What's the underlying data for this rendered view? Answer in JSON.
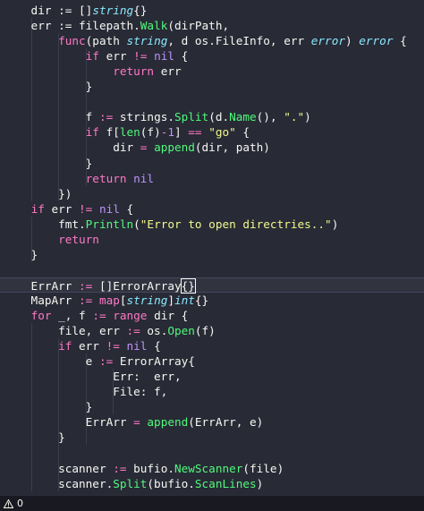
{
  "editor": {
    "lines": [
      [
        {
          "t": "    dir := []",
          "c": "pl"
        },
        {
          "t": "string",
          "c": "ty"
        },
        {
          "t": "{}",
          "c": "pl"
        }
      ],
      [
        {
          "t": "    err := filepath.",
          "c": "pl"
        },
        {
          "t": "Walk",
          "c": "fn"
        },
        {
          "t": "(dirPath,",
          "c": "pl"
        }
      ],
      [
        {
          "t": "        ",
          "c": "pl"
        },
        {
          "t": "func",
          "c": "kw"
        },
        {
          "t": "(path ",
          "c": "pl"
        },
        {
          "t": "string",
          "c": "ty"
        },
        {
          "t": ", d os.FileInfo, err ",
          "c": "pl"
        },
        {
          "t": "error",
          "c": "ty"
        },
        {
          "t": ") ",
          "c": "pl"
        },
        {
          "t": "error",
          "c": "ty"
        },
        {
          "t": " {",
          "c": "pl"
        }
      ],
      [
        {
          "t": "            ",
          "c": "pl"
        },
        {
          "t": "if",
          "c": "kw"
        },
        {
          "t": " err ",
          "c": "pl"
        },
        {
          "t": "!=",
          "c": "kw"
        },
        {
          "t": " ",
          "c": "pl"
        },
        {
          "t": "nil",
          "c": "cn"
        },
        {
          "t": " {",
          "c": "pl"
        }
      ],
      [
        {
          "t": "                ",
          "c": "pl"
        },
        {
          "t": "return",
          "c": "kw"
        },
        {
          "t": " err",
          "c": "pl"
        }
      ],
      [
        {
          "t": "            }",
          "c": "pl"
        }
      ],
      [],
      [
        {
          "t": "            f ",
          "c": "pl"
        },
        {
          "t": ":=",
          "c": "kw"
        },
        {
          "t": " strings.",
          "c": "pl"
        },
        {
          "t": "Split",
          "c": "fn"
        },
        {
          "t": "(d.",
          "c": "pl"
        },
        {
          "t": "Name",
          "c": "fn"
        },
        {
          "t": "(), ",
          "c": "pl"
        },
        {
          "t": "\".\"",
          "c": "st"
        },
        {
          "t": ")",
          "c": "pl"
        }
      ],
      [
        {
          "t": "            ",
          "c": "pl"
        },
        {
          "t": "if",
          "c": "kw"
        },
        {
          "t": " f[",
          "c": "pl"
        },
        {
          "t": "len",
          "c": "fn"
        },
        {
          "t": "(f)",
          "c": "pl"
        },
        {
          "t": "-",
          "c": "kw"
        },
        {
          "t": "1",
          "c": "cn"
        },
        {
          "t": "] ",
          "c": "pl"
        },
        {
          "t": "==",
          "c": "kw"
        },
        {
          "t": " ",
          "c": "pl"
        },
        {
          "t": "\"go\"",
          "c": "st"
        },
        {
          "t": " {",
          "c": "pl"
        }
      ],
      [
        {
          "t": "                dir ",
          "c": "pl"
        },
        {
          "t": "=",
          "c": "kw"
        },
        {
          "t": " ",
          "c": "pl"
        },
        {
          "t": "append",
          "c": "fn"
        },
        {
          "t": "(dir, path)",
          "c": "pl"
        }
      ],
      [
        {
          "t": "            }",
          "c": "pl"
        }
      ],
      [
        {
          "t": "            ",
          "c": "pl"
        },
        {
          "t": "return",
          "c": "kw"
        },
        {
          "t": " ",
          "c": "pl"
        },
        {
          "t": "nil",
          "c": "cn"
        }
      ],
      [
        {
          "t": "        })",
          "c": "pl"
        }
      ],
      [
        {
          "t": "    ",
          "c": "pl"
        },
        {
          "t": "if",
          "c": "kw"
        },
        {
          "t": " err ",
          "c": "pl"
        },
        {
          "t": "!=",
          "c": "kw"
        },
        {
          "t": " ",
          "c": "pl"
        },
        {
          "t": "nil",
          "c": "cn"
        },
        {
          "t": " {",
          "c": "pl"
        }
      ],
      [
        {
          "t": "        fmt.",
          "c": "pl"
        },
        {
          "t": "Println",
          "c": "fn"
        },
        {
          "t": "(",
          "c": "pl"
        },
        {
          "t": "\"Error to open directries..\"",
          "c": "st"
        },
        {
          "t": ")",
          "c": "pl"
        }
      ],
      [
        {
          "t": "        ",
          "c": "pl"
        },
        {
          "t": "return",
          "c": "kw"
        }
      ],
      [
        {
          "t": "    }",
          "c": "pl"
        }
      ],
      [],
      [
        {
          "t": "    ErrArr ",
          "c": "pl"
        },
        {
          "t": ":=",
          "c": "kw"
        },
        {
          "t": " []ErrorArray",
          "c": "pl"
        },
        {
          "t": "{}",
          "c": "pl",
          "box": true
        }
      ],
      [
        {
          "t": "    MapArr ",
          "c": "pl"
        },
        {
          "t": ":=",
          "c": "kw"
        },
        {
          "t": " ",
          "c": "pl"
        },
        {
          "t": "map",
          "c": "kw"
        },
        {
          "t": "[",
          "c": "pl"
        },
        {
          "t": "string",
          "c": "ty"
        },
        {
          "t": "]",
          "c": "pl"
        },
        {
          "t": "int",
          "c": "ty"
        },
        {
          "t": "{}",
          "c": "pl"
        }
      ],
      [
        {
          "t": "    ",
          "c": "pl"
        },
        {
          "t": "for",
          "c": "kw"
        },
        {
          "t": " _, f ",
          "c": "pl"
        },
        {
          "t": ":=",
          "c": "kw"
        },
        {
          "t": " ",
          "c": "pl"
        },
        {
          "t": "range",
          "c": "kw"
        },
        {
          "t": " dir {",
          "c": "pl"
        }
      ],
      [
        {
          "t": "        file, err ",
          "c": "pl"
        },
        {
          "t": ":=",
          "c": "kw"
        },
        {
          "t": " os.",
          "c": "pl"
        },
        {
          "t": "Open",
          "c": "fn"
        },
        {
          "t": "(f)",
          "c": "pl"
        }
      ],
      [
        {
          "t": "        ",
          "c": "pl"
        },
        {
          "t": "if",
          "c": "kw"
        },
        {
          "t": " err ",
          "c": "pl"
        },
        {
          "t": "!=",
          "c": "kw"
        },
        {
          "t": " ",
          "c": "pl"
        },
        {
          "t": "nil",
          "c": "cn"
        },
        {
          "t": " {",
          "c": "pl"
        }
      ],
      [
        {
          "t": "            e ",
          "c": "pl"
        },
        {
          "t": ":=",
          "c": "kw"
        },
        {
          "t": " ErrorArray{",
          "c": "pl"
        }
      ],
      [
        {
          "t": "                Err:  err,",
          "c": "pl"
        }
      ],
      [
        {
          "t": "                File: f,",
          "c": "pl"
        }
      ],
      [
        {
          "t": "            }",
          "c": "pl"
        }
      ],
      [
        {
          "t": "            ErrArr ",
          "c": "pl"
        },
        {
          "t": "=",
          "c": "kw"
        },
        {
          "t": " ",
          "c": "pl"
        },
        {
          "t": "append",
          "c": "fn"
        },
        {
          "t": "(ErrArr, e)",
          "c": "pl"
        }
      ],
      [
        {
          "t": "        }",
          "c": "pl"
        }
      ],
      [],
      [
        {
          "t": "        scanner ",
          "c": "pl"
        },
        {
          "t": ":=",
          "c": "kw"
        },
        {
          "t": " bufio.",
          "c": "pl"
        },
        {
          "t": "NewScanner",
          "c": "fn"
        },
        {
          "t": "(file)",
          "c": "pl"
        }
      ],
      [
        {
          "t": "        scanner.",
          "c": "pl"
        },
        {
          "t": "Split",
          "c": "fn"
        },
        {
          "t": "(bufio.",
          "c": "pl"
        },
        {
          "t": "ScanLines",
          "c": "fn"
        },
        {
          "t": ")",
          "c": "pl"
        }
      ]
    ],
    "active_line": 18
  },
  "statusbar": {
    "warning_count": "0",
    "warning_icon": "warning-icon"
  },
  "colors": {
    "background": "#282a36",
    "keyword": "#ff79c6",
    "function": "#50fa7b",
    "type": "#8be9fd",
    "constant": "#bd93f9",
    "string": "#f1fa8c",
    "text": "#f8f8f2",
    "statusbar": "#191a21"
  }
}
